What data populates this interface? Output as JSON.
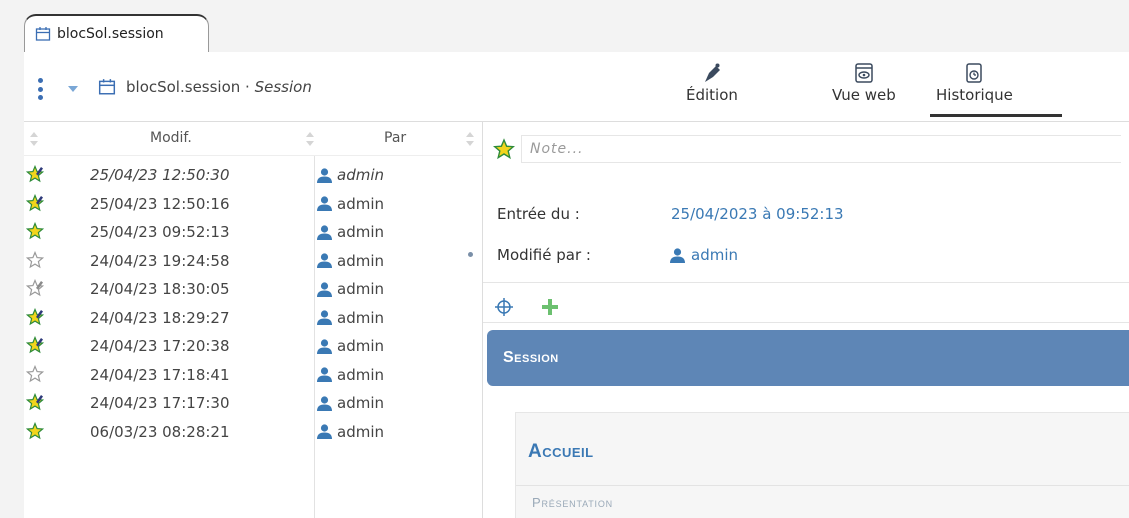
{
  "tab": {
    "label": "blocSol.session"
  },
  "breadcrumb": {
    "object": "blocSol.session",
    "separator": " · ",
    "type": "Session"
  },
  "toolbar": {
    "edition_label": "Édition",
    "vueweb_label": "Vue web",
    "historique_label": "Historique"
  },
  "list": {
    "headers": {
      "modif": "Modif.",
      "par": "Par"
    },
    "rows": [
      {
        "date": "25/04/23 12:50:30",
        "user": "admin",
        "mark": "star-edit"
      },
      {
        "date": "25/04/23 12:50:16",
        "user": "admin",
        "mark": "star-edit"
      },
      {
        "date": "25/04/23 09:52:13",
        "user": "admin",
        "mark": "star"
      },
      {
        "date": "24/04/23 19:24:58",
        "user": "admin",
        "mark": "star-outline"
      },
      {
        "date": "24/04/23 18:30:05",
        "user": "admin",
        "mark": "star-edit-outline"
      },
      {
        "date": "24/04/23 18:29:27",
        "user": "admin",
        "mark": "star-edit"
      },
      {
        "date": "24/04/23 17:20:38",
        "user": "admin",
        "mark": "star-edit"
      },
      {
        "date": "24/04/23 17:18:41",
        "user": "admin",
        "mark": "star-outline"
      },
      {
        "date": "24/04/23 17:17:30",
        "user": "admin",
        "mark": "star-edit"
      },
      {
        "date": "06/03/23 08:28:21",
        "user": "admin",
        "mark": "star"
      }
    ]
  },
  "detail": {
    "note_placeholder": "Note...",
    "entree_label": "Entrée du :",
    "entree_value": "25/04/2023 à 09:52:13",
    "modifie_label": "Modifié par :",
    "modifie_value": "admin",
    "session_label": "Session",
    "accueil_label": "Accueil",
    "presentation_label": "Présentation"
  },
  "colors": {
    "accent_blue": "#3a79b4",
    "session_bar": "#5e86b6",
    "star_yellow": "#f2d51c",
    "star_green": "#2e8b3a"
  }
}
